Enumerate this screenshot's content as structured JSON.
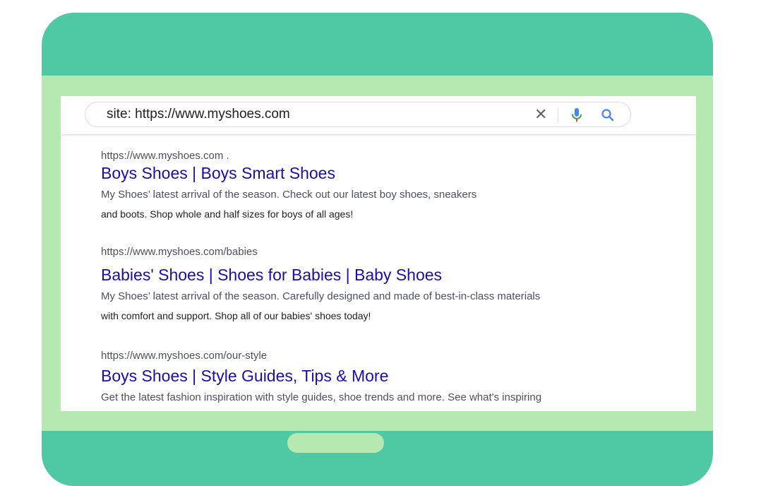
{
  "search": {
    "query": "site: https://www.myshoes.com",
    "clear_glyph": "✕"
  },
  "icons": {
    "clear": "close-icon",
    "mic": "microphone-icon",
    "search": "search-icon"
  },
  "colors": {
    "device": "#4fc8a4",
    "bezel": "#b5e9b0",
    "link": "#1a0dab",
    "snippet": "#4d5156",
    "mic_blue": "#4285f4",
    "mic_red": "#ea4335",
    "mic_yellow": "#fbbc05",
    "mic_green": "#34a853"
  },
  "results": [
    {
      "url": "https://www.myshoes.com .",
      "title": "Boys Shoes | Boys Smart Shoes",
      "snippet_line1": "My Shoes’ latest arrival of the season. Check out our latest boy shoes, sneakers",
      "snippet_line2": "and boots. Shop whole and half sizes for boys of all ages!"
    },
    {
      "url": "https://www.myshoes.com/babies",
      "title": "Babies' Shoes | Shoes for Babies | Baby Shoes",
      "snippet_line1": "My Shoes’ latest arrival of the season. Carefully designed and made of best-in-class materials",
      "snippet_line2": "with comfort and support. Shop all of our babies' shoes today!"
    },
    {
      "url": "https://www.myshoes.com/our-style",
      "title": "Boys Shoes | Style Guides, Tips & More",
      "snippet_line1": "Get the latest fashion inspiration with style guides, shoe trends and more. See what's inspiring",
      "snippet_line2": ""
    }
  ]
}
